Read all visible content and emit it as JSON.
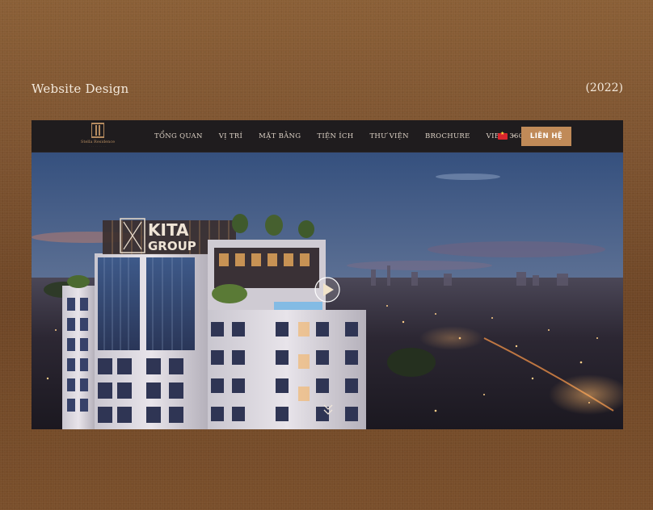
{
  "showcase": {
    "title": "Website Design",
    "year": "(2022)"
  },
  "website": {
    "logo": {
      "name": "Stella Residence",
      "tagline": "· · · · · · · · ·"
    },
    "nav": [
      "TỔNG QUAN",
      "VỊ TRÍ",
      "MẶT BẰNG",
      "TIỆN ÍCH",
      "THƯ VIỆN",
      "BROCHURE",
      "VIEW 360°"
    ],
    "language_flag": "vn-flag-icon",
    "cta_label": "LIÊN HỆ",
    "hero": {
      "building_sign": "KITA GROUP",
      "play_icon": "play-icon",
      "scroll_icon": "chevron-down-icon"
    },
    "colors": {
      "accent": "#c08a58",
      "nav_bg": "#1f1c1e",
      "page_bg": "#7d5330"
    }
  }
}
